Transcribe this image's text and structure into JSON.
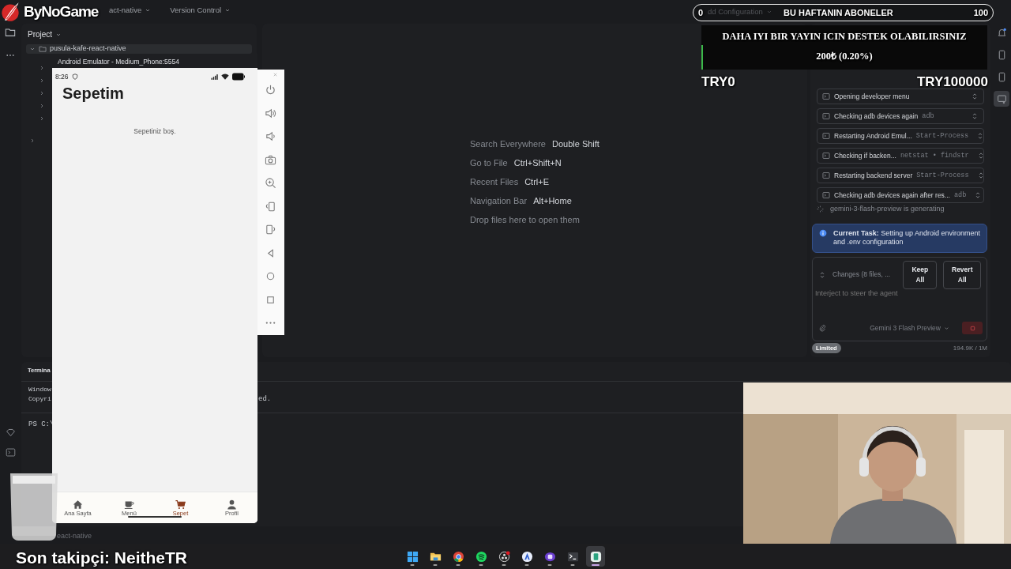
{
  "ide": {
    "menu": [
      "act-native",
      "Version Control"
    ],
    "run_config": "dd Configuration",
    "project_title": "Project",
    "project_root": "pusula-kafe-react-native",
    "editor_hints": [
      {
        "label": "Search Everywhere",
        "shortcut": "Double Shift"
      },
      {
        "label": "Go to File",
        "shortcut": "Ctrl+Shift+N"
      },
      {
        "label": "Recent Files",
        "shortcut": "Ctrl+E"
      },
      {
        "label": "Navigation Bar",
        "shortcut": "Alt+Home"
      }
    ],
    "drop_hint": "Drop files here to open them",
    "right_strip": [
      {
        "selected": false
      },
      {
        "selected": false
      },
      {
        "selected": false
      },
      {
        "selected": true
      }
    ],
    "terminal": {
      "tab": "Termina",
      "lines": [
        "Window",
        "Copyri"
      ],
      "line_tail": "ed.",
      "prompt": "PS C:\\"
    },
    "status_path": "eact-native"
  },
  "agent": {
    "steps": [
      {
        "label": "Opening developer menu"
      },
      {
        "label": "Checking adb devices again",
        "command": "adb"
      },
      {
        "label": "Restarting Android Emul...",
        "command": "Start-Process"
      },
      {
        "label": "Checking if backen...",
        "command": "netstat • findstr"
      },
      {
        "label": "Restarting backend server",
        "command": "Start-Process"
      },
      {
        "label": "Checking adb devices again after res...",
        "command": "adb"
      }
    ],
    "status": "gemini-3-flash-preview is generating",
    "task": "**Current Task:** Setting up Android environment and .env configuration",
    "changes": "Changes (8 files, ...",
    "buttons": [
      "Keep All",
      "Revert All"
    ],
    "placeholder": "Interject to steer the agent",
    "model": "Gemini 3 Flash Preview",
    "badge": "Limited",
    "tokens": "194.9K / 1M"
  },
  "emulator": {
    "title": "Android Emulator - Medium_Phone:5554",
    "time": "8:26",
    "screen_title": "Sepetim",
    "empty_text": "Sepetiniz boş.",
    "nav": [
      {
        "label": "Ana Sayfa",
        "selected": false
      },
      {
        "label": "Menü",
        "selected": false
      },
      {
        "label": "Sepet",
        "selected": true
      },
      {
        "label": "Profil",
        "selected": false
      }
    ]
  },
  "overlay": {
    "logo": "ByNoGame",
    "sub_goal": {
      "start": "0",
      "title": "BU HAFTANIN ABONELER",
      "end": "100",
      "level": 0
    },
    "donation": {
      "title": "DAHA IYI BIR YAYIN ICIN DESTEK OLABILIRSINIZ",
      "amount": "200₺ (0.20%)",
      "level": 0.002,
      "start": "TRY0",
      "end": "TRY100000"
    },
    "last_follower": "Son takipçi: NeitheTR"
  },
  "taskbar": [
    {
      "selected": false
    },
    {
      "selected": false
    },
    {
      "selected": false
    },
    {
      "selected": false
    },
    {
      "selected": false
    },
    {
      "selected": false
    },
    {
      "selected": false
    },
    {
      "selected": false
    },
    {
      "selected": true
    }
  ]
}
